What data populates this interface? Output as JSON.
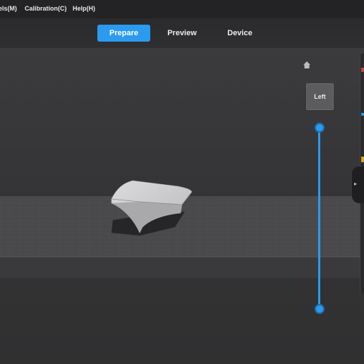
{
  "menubar": {
    "items": [
      {
        "label": "els(M)"
      },
      {
        "label": "Calibration(C)"
      },
      {
        "label": "Help(H)"
      }
    ]
  },
  "nav": {
    "tabs": [
      {
        "label": "Prepare",
        "active": true
      },
      {
        "label": "Preview",
        "active": false
      },
      {
        "label": "Device",
        "active": false
      }
    ]
  },
  "viewport": {
    "view_cube_label": "Left",
    "home_icon": "home-icon",
    "layer_slider": {
      "color": "#2a9bf0"
    }
  },
  "colors": {
    "accent": "#2a9bf0",
    "menubar_bg": "#232326",
    "viewport_bg": "#343436",
    "plate": "#4a4a4c",
    "model": "#cfcfd1"
  }
}
